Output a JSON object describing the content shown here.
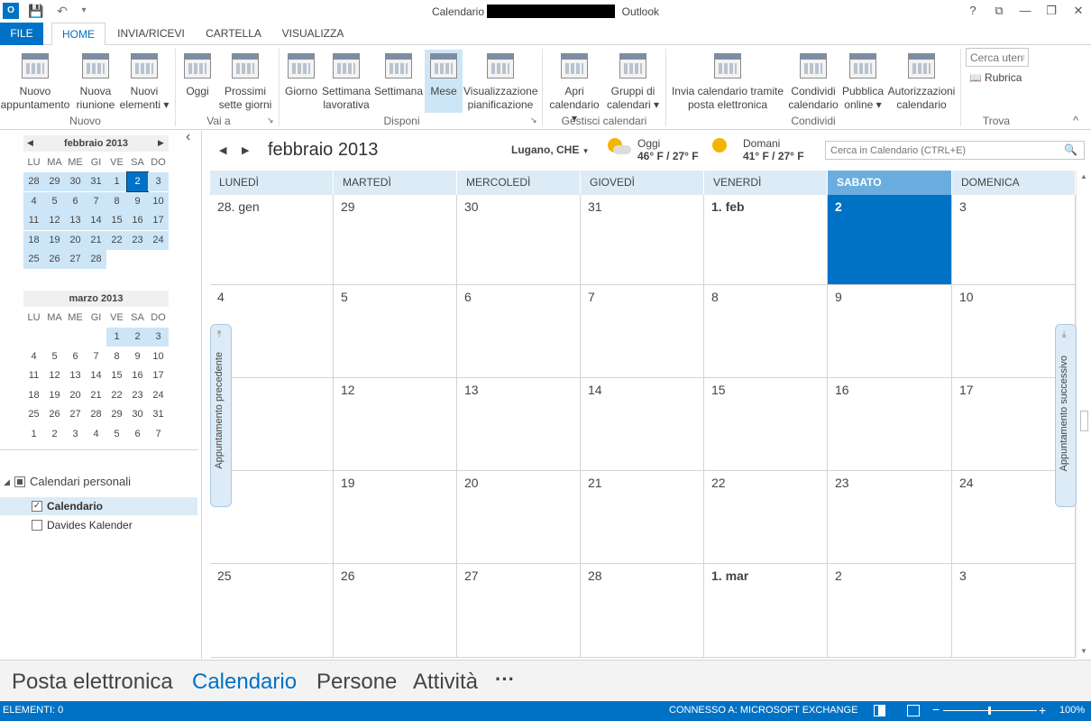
{
  "window": {
    "app_icon": "O",
    "title_prefix": "Calendario - ",
    "title_suffix": "Outlook",
    "help": "?",
    "min": "—",
    "restore": "❐",
    "close": "✕",
    "ribbon_display": "⧉"
  },
  "qat": {
    "save": "💾",
    "undo": "↶",
    "customize": "▾"
  },
  "tabs": [
    "FILE",
    "HOME",
    "INVIA/RICEVI",
    "CARTELLA",
    "VISUALIZZA"
  ],
  "ribbon": {
    "buttons": [
      {
        "l1": "Nuovo",
        "l2": "appuntamento"
      },
      {
        "l1": "Nuova",
        "l2": "riunione"
      },
      {
        "l1": "Nuovi",
        "l2": "elementi ▾"
      },
      {
        "l1": "Oggi",
        "l2": ""
      },
      {
        "l1": "Prossimi",
        "l2": "sette giorni"
      },
      {
        "l1": "Giorno",
        "l2": ""
      },
      {
        "l1": "Settimana",
        "l2": "lavorativa"
      },
      {
        "l1": "Settimana",
        "l2": ""
      },
      {
        "l1": "Mese",
        "l2": ""
      },
      {
        "l1": "Visualizzazione",
        "l2": "pianificazione"
      },
      {
        "l1": "Apri",
        "l2": "calendario ▾"
      },
      {
        "l1": "Gruppi di",
        "l2": "calendari ▾"
      },
      {
        "l1": "Invia calendario tramite",
        "l2": "posta elettronica"
      },
      {
        "l1": "Condividi",
        "l2": "calendario"
      },
      {
        "l1": "Pubblica",
        "l2": "online ▾"
      },
      {
        "l1": "Autorizzazioni",
        "l2": "calendario"
      }
    ],
    "groups": [
      "Nuovo",
      "Vai a",
      "Disponi",
      "Gestisci calendari",
      "Condividi",
      "Trova"
    ],
    "launcher": "↘",
    "search_users_placeholder": "Cerca utenti",
    "rubrica": "Rubrica",
    "rubrica_icon": "📖",
    "collapse": "^"
  },
  "mini_calendars": [
    {
      "title": "febbraio 2013",
      "prev": "◀",
      "next": "▶",
      "dow": [
        "LU",
        "MA",
        "ME",
        "GI",
        "VE",
        "SA",
        "DO"
      ],
      "rows": [
        [
          "28",
          "29",
          "30",
          "31",
          "1",
          "2",
          "3"
        ],
        [
          "4",
          "5",
          "6",
          "7",
          "8",
          "9",
          "10"
        ],
        [
          "11",
          "12",
          "13",
          "14",
          "15",
          "16",
          "17"
        ],
        [
          "18",
          "19",
          "20",
          "21",
          "22",
          "23",
          "24"
        ],
        [
          "25",
          "26",
          "27",
          "28",
          "",
          "",
          ""
        ]
      ]
    },
    {
      "title": "marzo 2013",
      "dow": [
        "LU",
        "MA",
        "ME",
        "GI",
        "VE",
        "SA",
        "DO"
      ],
      "rows": [
        [
          "",
          "",
          "",
          "",
          "1",
          "2",
          "3"
        ],
        [
          "4",
          "5",
          "6",
          "7",
          "8",
          "9",
          "10"
        ],
        [
          "11",
          "12",
          "13",
          "14",
          "15",
          "16",
          "17"
        ],
        [
          "18",
          "19",
          "20",
          "21",
          "22",
          "23",
          "24"
        ],
        [
          "25",
          "26",
          "27",
          "28",
          "29",
          "30",
          "31"
        ],
        [
          "1",
          "2",
          "3",
          "4",
          "5",
          "6",
          "7"
        ]
      ]
    }
  ],
  "calendars": {
    "group_label": "Calendari personali",
    "group_toggle": "◢",
    "items": [
      {
        "label": "Calendario",
        "checked": "✓"
      },
      {
        "label": "Davides Kalender",
        "checked": ""
      }
    ]
  },
  "calendar": {
    "collapse_pane": "‹",
    "prev": "◀",
    "next": "▶",
    "month_title": "febbraio 2013",
    "location": "Lugano, CHE",
    "location_caret": "▼",
    "weather": [
      {
        "label": "Oggi",
        "temp": "46° F / 27° F"
      },
      {
        "label": "Domani",
        "temp": "41° F / 27° F"
      }
    ],
    "search_placeholder": "Cerca in Calendario (CTRL+E)",
    "search_icon": "🔍",
    "days": [
      "LUNEDÌ",
      "MARTEDÌ",
      "MERCOLEDÌ",
      "GIOVEDÌ",
      "VENERDÌ",
      "SABATO",
      "DOMENICA"
    ],
    "weeks": [
      [
        "28. gen",
        "29",
        "30",
        "31",
        "1. feb",
        "2",
        "3"
      ],
      [
        "4",
        "5",
        "6",
        "7",
        "8",
        "9",
        "10"
      ],
      [
        "",
        "12",
        "13",
        "14",
        "15",
        "16",
        "17"
      ],
      [
        "",
        "19",
        "20",
        "21",
        "22",
        "23",
        "24"
      ],
      [
        "25",
        "26",
        "27",
        "28",
        "1. mar",
        "2",
        "3"
      ]
    ],
    "prev_appointment": "Appuntamento precedente",
    "next_appointment": "Appuntamento successivo",
    "prev_arrow": "⇤",
    "next_arrow": "⇥",
    "scroll_up": "▲",
    "scroll_down": "▼"
  },
  "bottom_nav": [
    "Posta elettronica",
    "Calendario",
    "Persone",
    "Attività",
    "···"
  ],
  "status": {
    "items": "ELEMENTI: 0",
    "connection": "CONNESSO A: MICROSOFT EXCHANGE",
    "zoom": "100%",
    "zoom_minus": "−",
    "zoom_plus": "+"
  },
  "colors": {
    "accent": "#0072c6",
    "selected_light": "#cde6f7",
    "header_bg": "#dcebf6"
  }
}
